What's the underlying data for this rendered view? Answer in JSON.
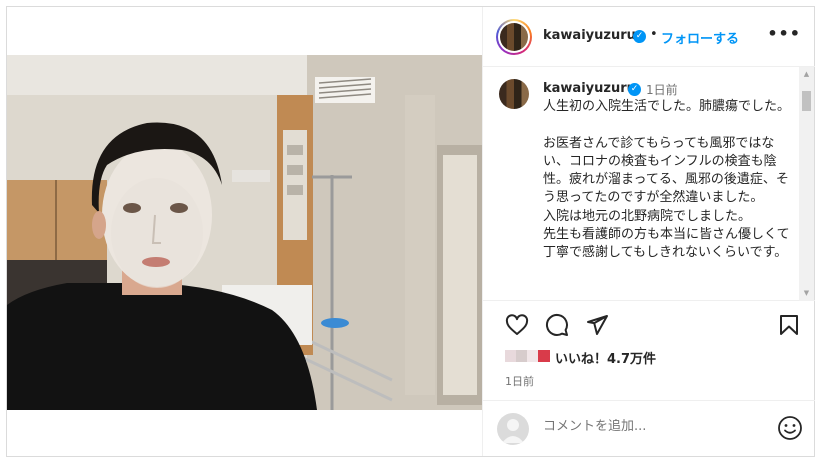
{
  "post": {
    "username": "kawaiyuzuru",
    "follow_label": "フォローする",
    "separator": "•",
    "more_label": "•••"
  },
  "caption": {
    "username": "kawaiyuzuru",
    "time": "1日前",
    "text": "人生初の入院生活でした。肺膿瘍でした。\n\nお医者さんで診てもらっても風邪ではない、コロナの検査もインフルの検査も陰性。疲れが溜まってる、風邪の後遺症、そう思ってたのですが全然違いました。\n入院は地元の北野病院でしました。\n先生も看護師の方も本当に皆さん優しくて丁寧で感謝してもしきれないくらいです。"
  },
  "icons": {
    "verified": "verified-badge-icon",
    "like": "heart-icon",
    "comment": "comment-bubble-icon",
    "share": "paper-plane-icon",
    "save": "bookmark-icon",
    "emoji": "smiley-face-icon",
    "more": "ellipsis-icon"
  },
  "likes": {
    "text": "いいね！4.7万件"
  },
  "timestamp": "1日前",
  "comment_box": {
    "placeholder": "コメントを追加..."
  },
  "colors": {
    "accent_blue": "#0095f6",
    "text": "#262626",
    "secondary": "#737373",
    "border": "#efefef"
  }
}
